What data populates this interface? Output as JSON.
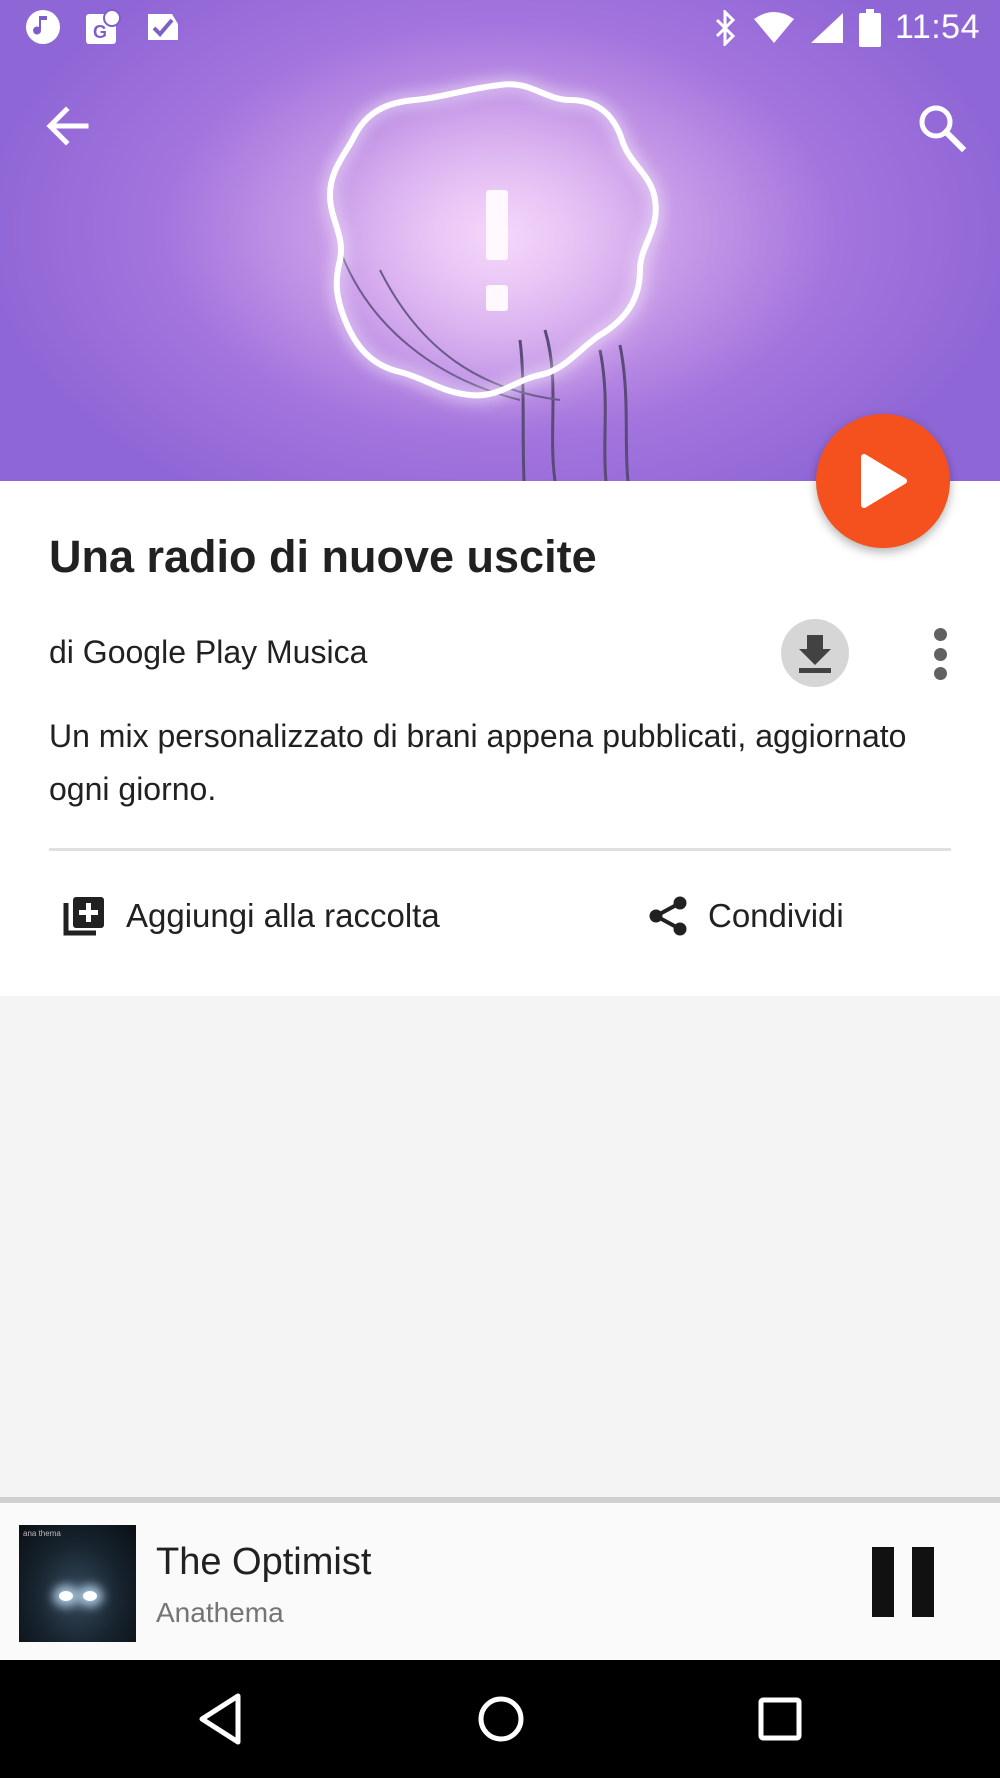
{
  "status_bar": {
    "time": "11:54",
    "left_icons": [
      "music-notification-icon",
      "maps-notification-icon",
      "inbox-done-icon"
    ],
    "right_icons": [
      "bluetooth-icon",
      "wifi-icon",
      "signal-icon",
      "battery-icon"
    ]
  },
  "toolbar": {
    "back_icon": "arrow-back-icon",
    "search_icon": "search-icon"
  },
  "station": {
    "title": "Una radio di nuove uscite",
    "byline": "di Google Play Musica",
    "description": "Un mix personalizzato di brani appena pubblicati, aggiornato ogni giorno."
  },
  "actions": {
    "add_label": "Aggiungi alla raccolta",
    "share_label": "Condividi"
  },
  "now_playing": {
    "title": "The Optimist",
    "artist": "Anathema",
    "album_art_text": "ana thema"
  },
  "colors": {
    "fab": "#f4511e",
    "hero": "#a374dd"
  }
}
